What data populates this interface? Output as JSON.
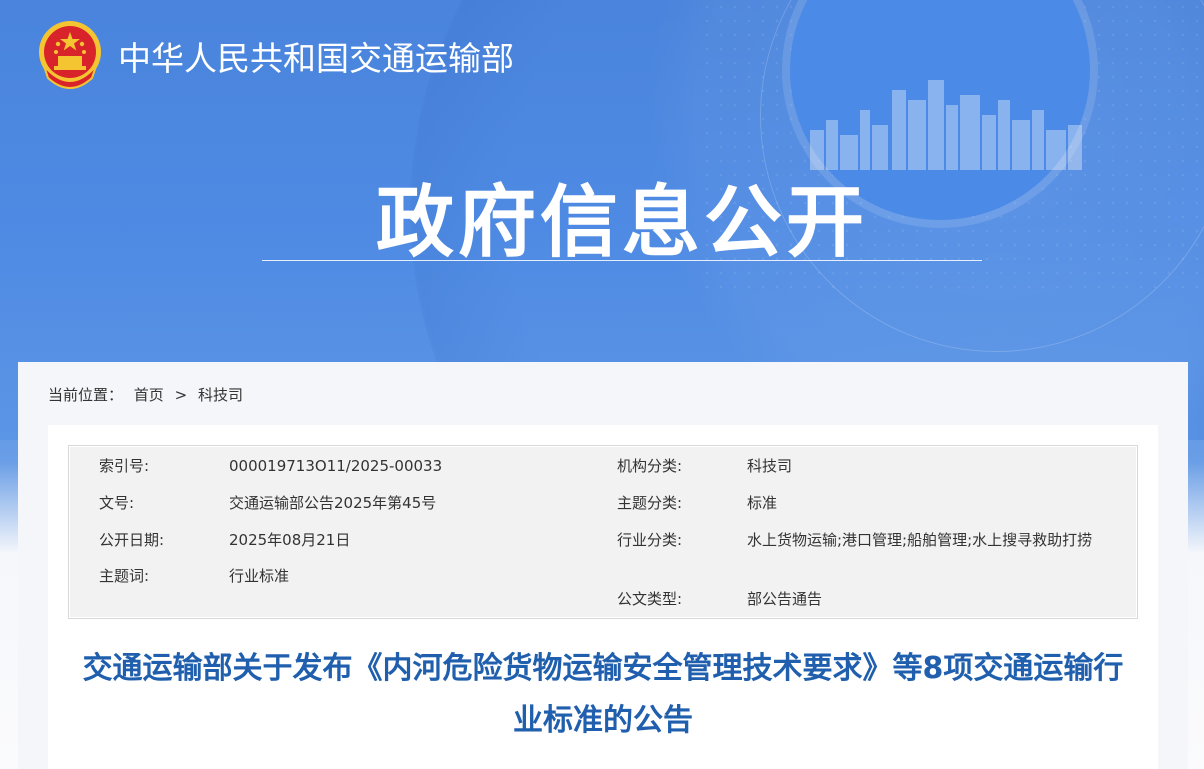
{
  "header": {
    "site_name": "中华人民共和国交通运输部",
    "section_title": "政府信息公开"
  },
  "breadcrumb": {
    "prefix": "当前位置：",
    "items": [
      "首页",
      ">",
      "科技司"
    ]
  },
  "meta": {
    "left": [
      {
        "label": "索引号:",
        "value": "000019713O11/2025-00033"
      },
      {
        "label": "文号:",
        "value": "交通运输部公告2025年第45号"
      },
      {
        "label": "公开日期:",
        "value": "2025年08月21日"
      },
      {
        "label": "主题词:",
        "value": "行业标准"
      }
    ],
    "right": [
      {
        "label": "机构分类:",
        "value": "科技司"
      },
      {
        "label": "主题分类:",
        "value": "标准"
      },
      {
        "label": "行业分类:",
        "value": "水上货物运输;港口管理;船舶管理;水上搜寻救助打捞"
      },
      {
        "label": "公文类型:",
        "value": "部公告通告"
      }
    ]
  },
  "document": {
    "title": "交通运输部关于发布《内河危险货物运输安全管理技术要求》等8项交通运输行业标准的公告"
  },
  "colors": {
    "banner_blue": "#4b86dd",
    "title_blue": "#1f5fad",
    "emblem_red": "#d8232a",
    "emblem_gold": "#f5c531"
  },
  "icons": {
    "emblem": "national-emblem-icon"
  }
}
